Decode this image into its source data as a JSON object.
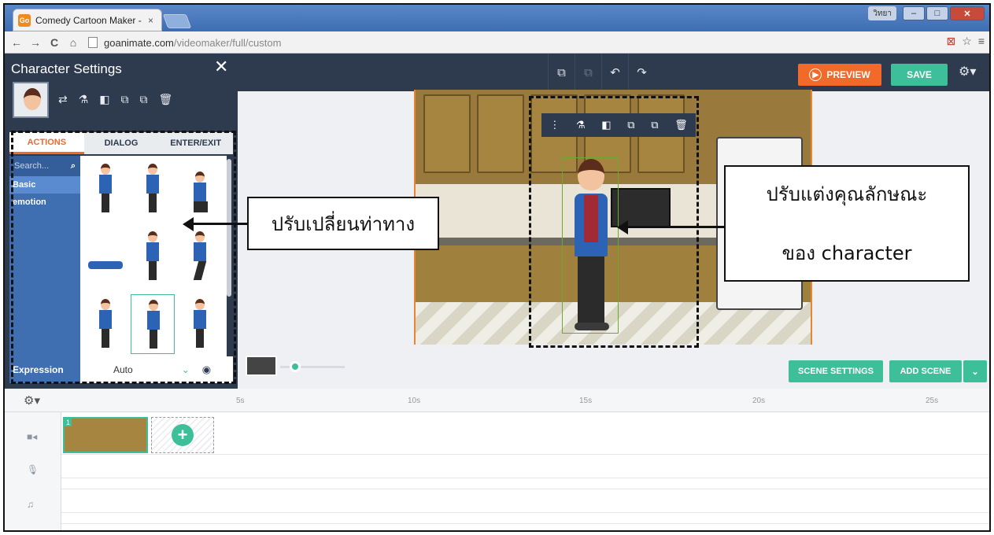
{
  "browser": {
    "tab_title": "Comedy Cartoon Maker -",
    "tab_close": "×",
    "favicon_text": "Go",
    "user_badge": "วิทยา",
    "url_host": "goanimate.com",
    "url_path": "/videomaker/full/custom",
    "nav": {
      "back": "←",
      "forward": "→",
      "reload": "C",
      "home": "⌂"
    },
    "right_icons": {
      "ext": "⊠",
      "star": "☆",
      "menu": "≡"
    },
    "window": {
      "minimize": "–",
      "maximize": "□",
      "close": "✕"
    }
  },
  "header": {
    "tools": [
      "⧉",
      "⧉",
      "↶",
      "↷"
    ],
    "preview_label": "PREVIEW",
    "preview_icon": "▶",
    "save_label": "SAVE",
    "settings_icon": "⚙▾"
  },
  "panel": {
    "title": "Character Settings",
    "close": "✕",
    "tools": [
      "⇄",
      "⚗",
      "◧",
      "⧉",
      "⧉",
      "🗑"
    ],
    "tabs": [
      "ACTIONS",
      "DIALOG",
      "ENTER/EXIT"
    ],
    "search_placeholder": "Search...",
    "search_icon": "⌕",
    "categories": [
      "Basic",
      "emotion"
    ],
    "expression_label": "Expression",
    "expression_value": "Auto",
    "chevron": "⌄",
    "eye_icon": "◉"
  },
  "stage": {
    "float_tools": [
      "⋮",
      "⚗",
      "◧",
      "⧉",
      "⧉",
      "🗑"
    ]
  },
  "annotations": {
    "callout_left": "ปรับเปลี่ยนท่าทาง",
    "callout_right_line1": "ปรับแต่งคุณลักษณะ",
    "callout_right_line2": "ของ character"
  },
  "scene_buttons": {
    "scene_settings": "SCENE SETTINGS",
    "add_scene": "ADD SCENE",
    "add_scene_dropdown": "⌄"
  },
  "timeline": {
    "gear": "⚙▾",
    "ticks": [
      "5s",
      "10s",
      "15s",
      "20s",
      "25s"
    ],
    "track_icons": [
      "■◂",
      "🎙",
      "♫"
    ],
    "scene_number": "1",
    "add_icon": "+"
  },
  "colors": {
    "accent_orange": "#f26a2a",
    "accent_green": "#3dbf9a",
    "header_bg": "#2e3a4e"
  }
}
